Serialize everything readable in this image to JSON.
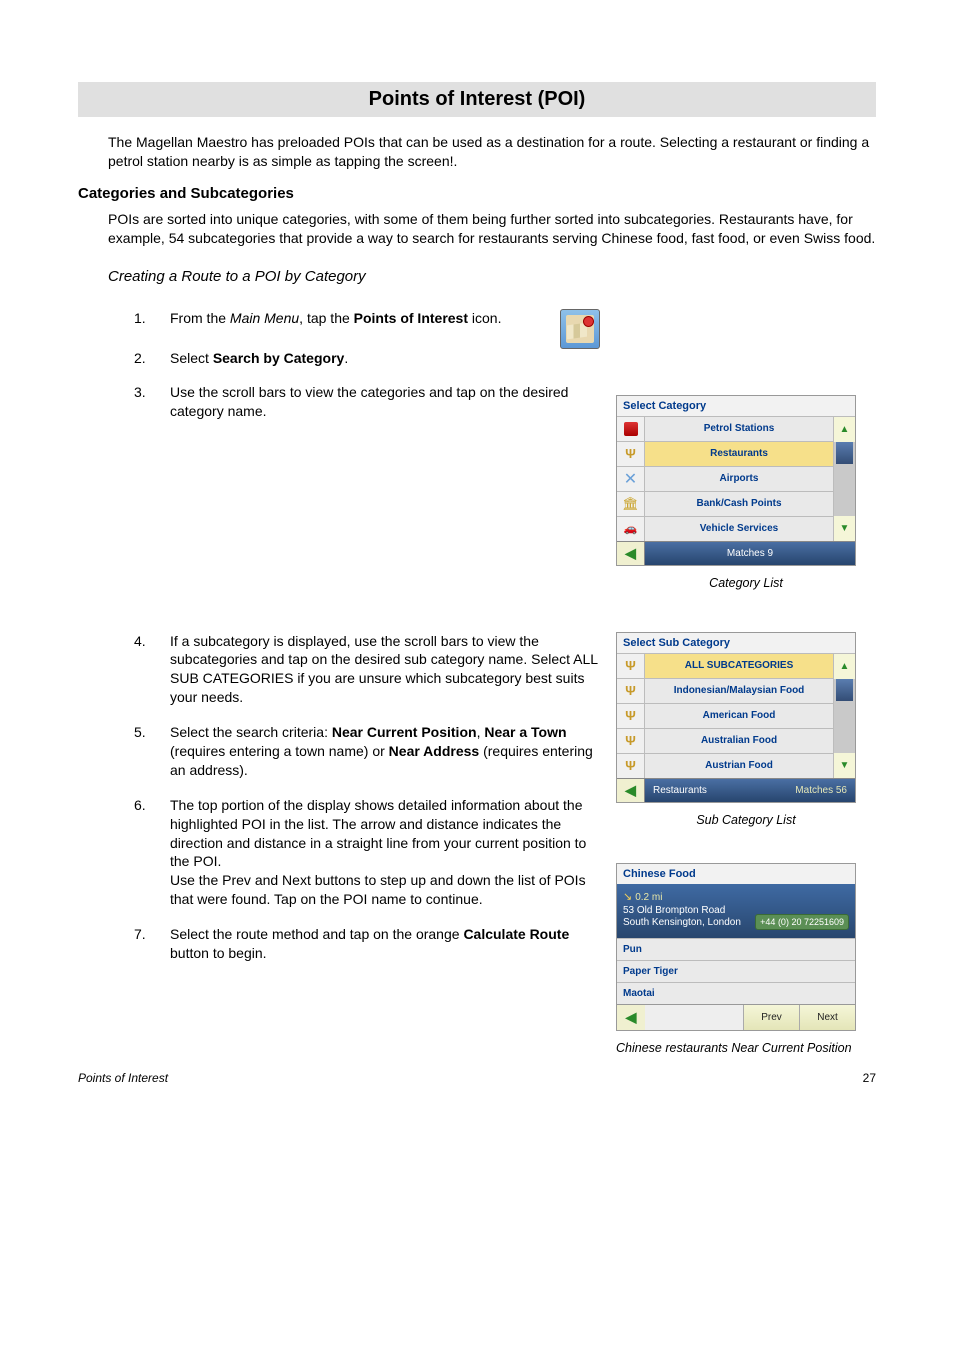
{
  "page": {
    "title": "Points of Interest (POI)",
    "intro": "The Magellan Maestro has preloaded POIs that can be used as a destination for a route.  Selecting a restaurant or finding a petrol station nearby is as simple as tapping the screen!.",
    "section_heading": "Categories and Subcategories",
    "section_para": "POIs are sorted into unique categories, with some of them being further sorted into subcategories.  Restaurants have, for example, 54 subcategories that provide a way to search for restaurants serving Chinese food, fast food, or even Swiss food.",
    "sub_heading": "Creating a Route to a POI by Category"
  },
  "steps": {
    "s1_a": "From the ",
    "s1_b": "Main Menu",
    "s1_c": ", tap the ",
    "s1_d": "Points of Interest",
    "s1_e": " icon.",
    "s2_a": "Select ",
    "s2_b": "Search by Category",
    "s2_c": ".",
    "s3": "Use the scroll bars to view the categories and tap on the desired category name.",
    "s4": "If a subcategory is displayed, use the scroll bars to view the subcategories and tap on the desired sub category name.  Select ALL SUB CATEGORIES if you are unsure which subcategory best suits your needs.",
    "s5_a": "Select the search criteria: ",
    "s5_b": "Near Current Position",
    "s5_c": ", ",
    "s5_d": "Near a Town",
    "s5_e": " (requires entering a town name) or ",
    "s5_f": "Near Address",
    "s5_g": " (requires entering an address).",
    "s6_a": "The top portion of the display shows detailed information about the highlighted POI in the list.  The arrow and distance indicates the direction and distance in a straight line from your current position to the POI.",
    "s6_b": "Use the Prev and Next buttons to step up and down the list of POIs that were found.  Tap on the POI name to continue.",
    "s7_a": "Select the route method and tap on the orange ",
    "s7_b": "Calculate Route",
    "s7_c": " button to begin."
  },
  "category_screen": {
    "title": "Select Category",
    "items": [
      {
        "label": "Petrol Stations",
        "icon": "petrol"
      },
      {
        "label": "Restaurants",
        "icon": "fork",
        "selected": true
      },
      {
        "label": "Airports",
        "icon": "air"
      },
      {
        "label": "Bank/Cash Points",
        "icon": "bank"
      },
      {
        "label": "Vehicle Services",
        "icon": "car"
      }
    ],
    "footer": "Matches  9",
    "caption": "Category List"
  },
  "subcategory_screen": {
    "title": "Select Sub Category",
    "items": [
      {
        "label": "ALL SUBCATEGORIES",
        "selected": true
      },
      {
        "label": "Indonesian/Malaysian Food"
      },
      {
        "label": "American Food"
      },
      {
        "label": "Australian Food"
      },
      {
        "label": "Austrian Food"
      }
    ],
    "footer_left": "Restaurants",
    "footer_right": "Matches  56",
    "caption": "Sub Category List"
  },
  "results_screen": {
    "title": "Chinese Food",
    "distance": "0.2 mi",
    "addr1": "53 Old Brompton Road",
    "addr2": "South Kensington, London",
    "phone": "+44 (0) 20 72251609",
    "items": [
      "Pun",
      "Paper Tiger",
      "Maotai"
    ],
    "prev": "Prev",
    "next": "Next",
    "caption": "Chinese restaurants Near Current Position"
  },
  "footer": {
    "left": "Points of Interest",
    "page": "27"
  }
}
